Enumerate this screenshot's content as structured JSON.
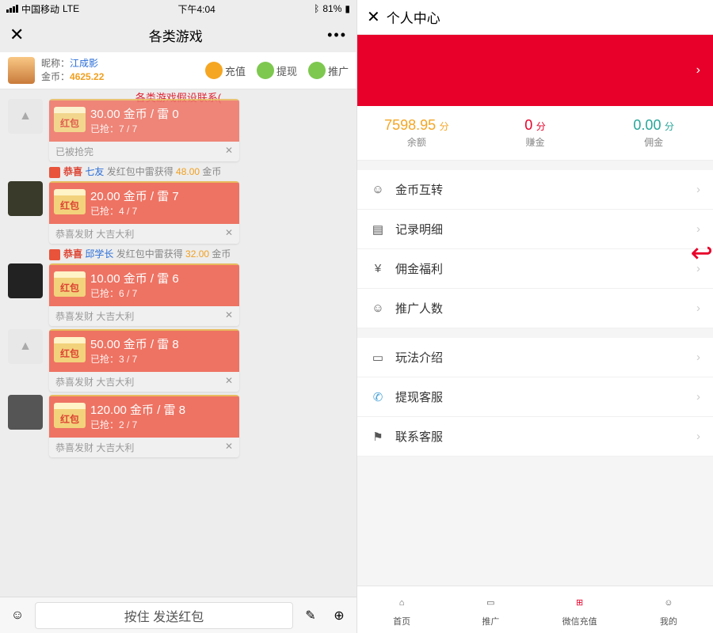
{
  "left": {
    "status": {
      "carrier": "中国移动",
      "net": "LTE",
      "time": "下午4:04",
      "battery": "81%"
    },
    "nav": {
      "title": "各类游戏"
    },
    "user": {
      "nick_label": "昵称：",
      "nick": "江成影",
      "coin_label": "金币：",
      "coin": "4625.22"
    },
    "actions": {
      "recharge": "充值",
      "withdraw": "提现",
      "promote": "推广"
    },
    "warning": "各类游戏假设联系(",
    "packets": [
      {
        "line1": "30.00 金币 / 雷 0",
        "line2": "已抢：7 / 7",
        "foot": "已被抢完",
        "done": true
      },
      {
        "line1": "20.00 金币 / 雷 7",
        "line2": "已抢：4 / 7",
        "foot": "恭喜发财 大吉大利"
      },
      {
        "line1": "10.00 金币 / 雷 6",
        "line2": "已抢：6 / 7",
        "foot": "恭喜发财 大吉大利"
      },
      {
        "line1": "50.00 金币 / 雷 8",
        "line2": "已抢：3 / 7",
        "foot": "恭喜发财 大吉大利"
      },
      {
        "line1": "120.00 金币 / 雷 8",
        "line2": "已抢：2 / 7",
        "foot": "恭喜发财 大吉大利"
      }
    ],
    "notices": [
      {
        "pre": "恭喜 ",
        "name": "七友",
        "mid": " 发红包中雷获得 ",
        "amt": "48.00",
        "suf": " 金币"
      },
      {
        "pre": "恭喜 ",
        "name": "邱学长",
        "mid": " 发红包中雷获得 ",
        "amt": "32.00",
        "suf": " 金币"
      }
    ],
    "rp_badge": "红包",
    "input_hint": "按住 发送红包"
  },
  "right": {
    "nav_title": "个人中心",
    "stats": [
      {
        "num": "7598.95",
        "unit": "分",
        "label": "余额",
        "cls": "c-orange"
      },
      {
        "num": "0",
        "unit": "分",
        "label": "赚金",
        "cls": "c-red"
      },
      {
        "num": "0.00",
        "unit": "分",
        "label": "佣金",
        "cls": "c-green"
      }
    ],
    "menu1": [
      {
        "icon": "☺",
        "label": "金币互转"
      },
      {
        "icon": "▤",
        "label": "记录明细"
      },
      {
        "icon": "¥",
        "label": "佣金福利"
      },
      {
        "icon": "☺",
        "label": "推广人数"
      }
    ],
    "menu2": [
      {
        "icon": "▭",
        "label": "玩法介绍"
      },
      {
        "icon": "✆",
        "label": "提现客服"
      },
      {
        "icon": "⚑",
        "label": "联系客服"
      }
    ],
    "tabs": [
      {
        "label": "首页"
      },
      {
        "label": "推广"
      },
      {
        "label": "微信充值"
      },
      {
        "label": "我的"
      }
    ]
  }
}
